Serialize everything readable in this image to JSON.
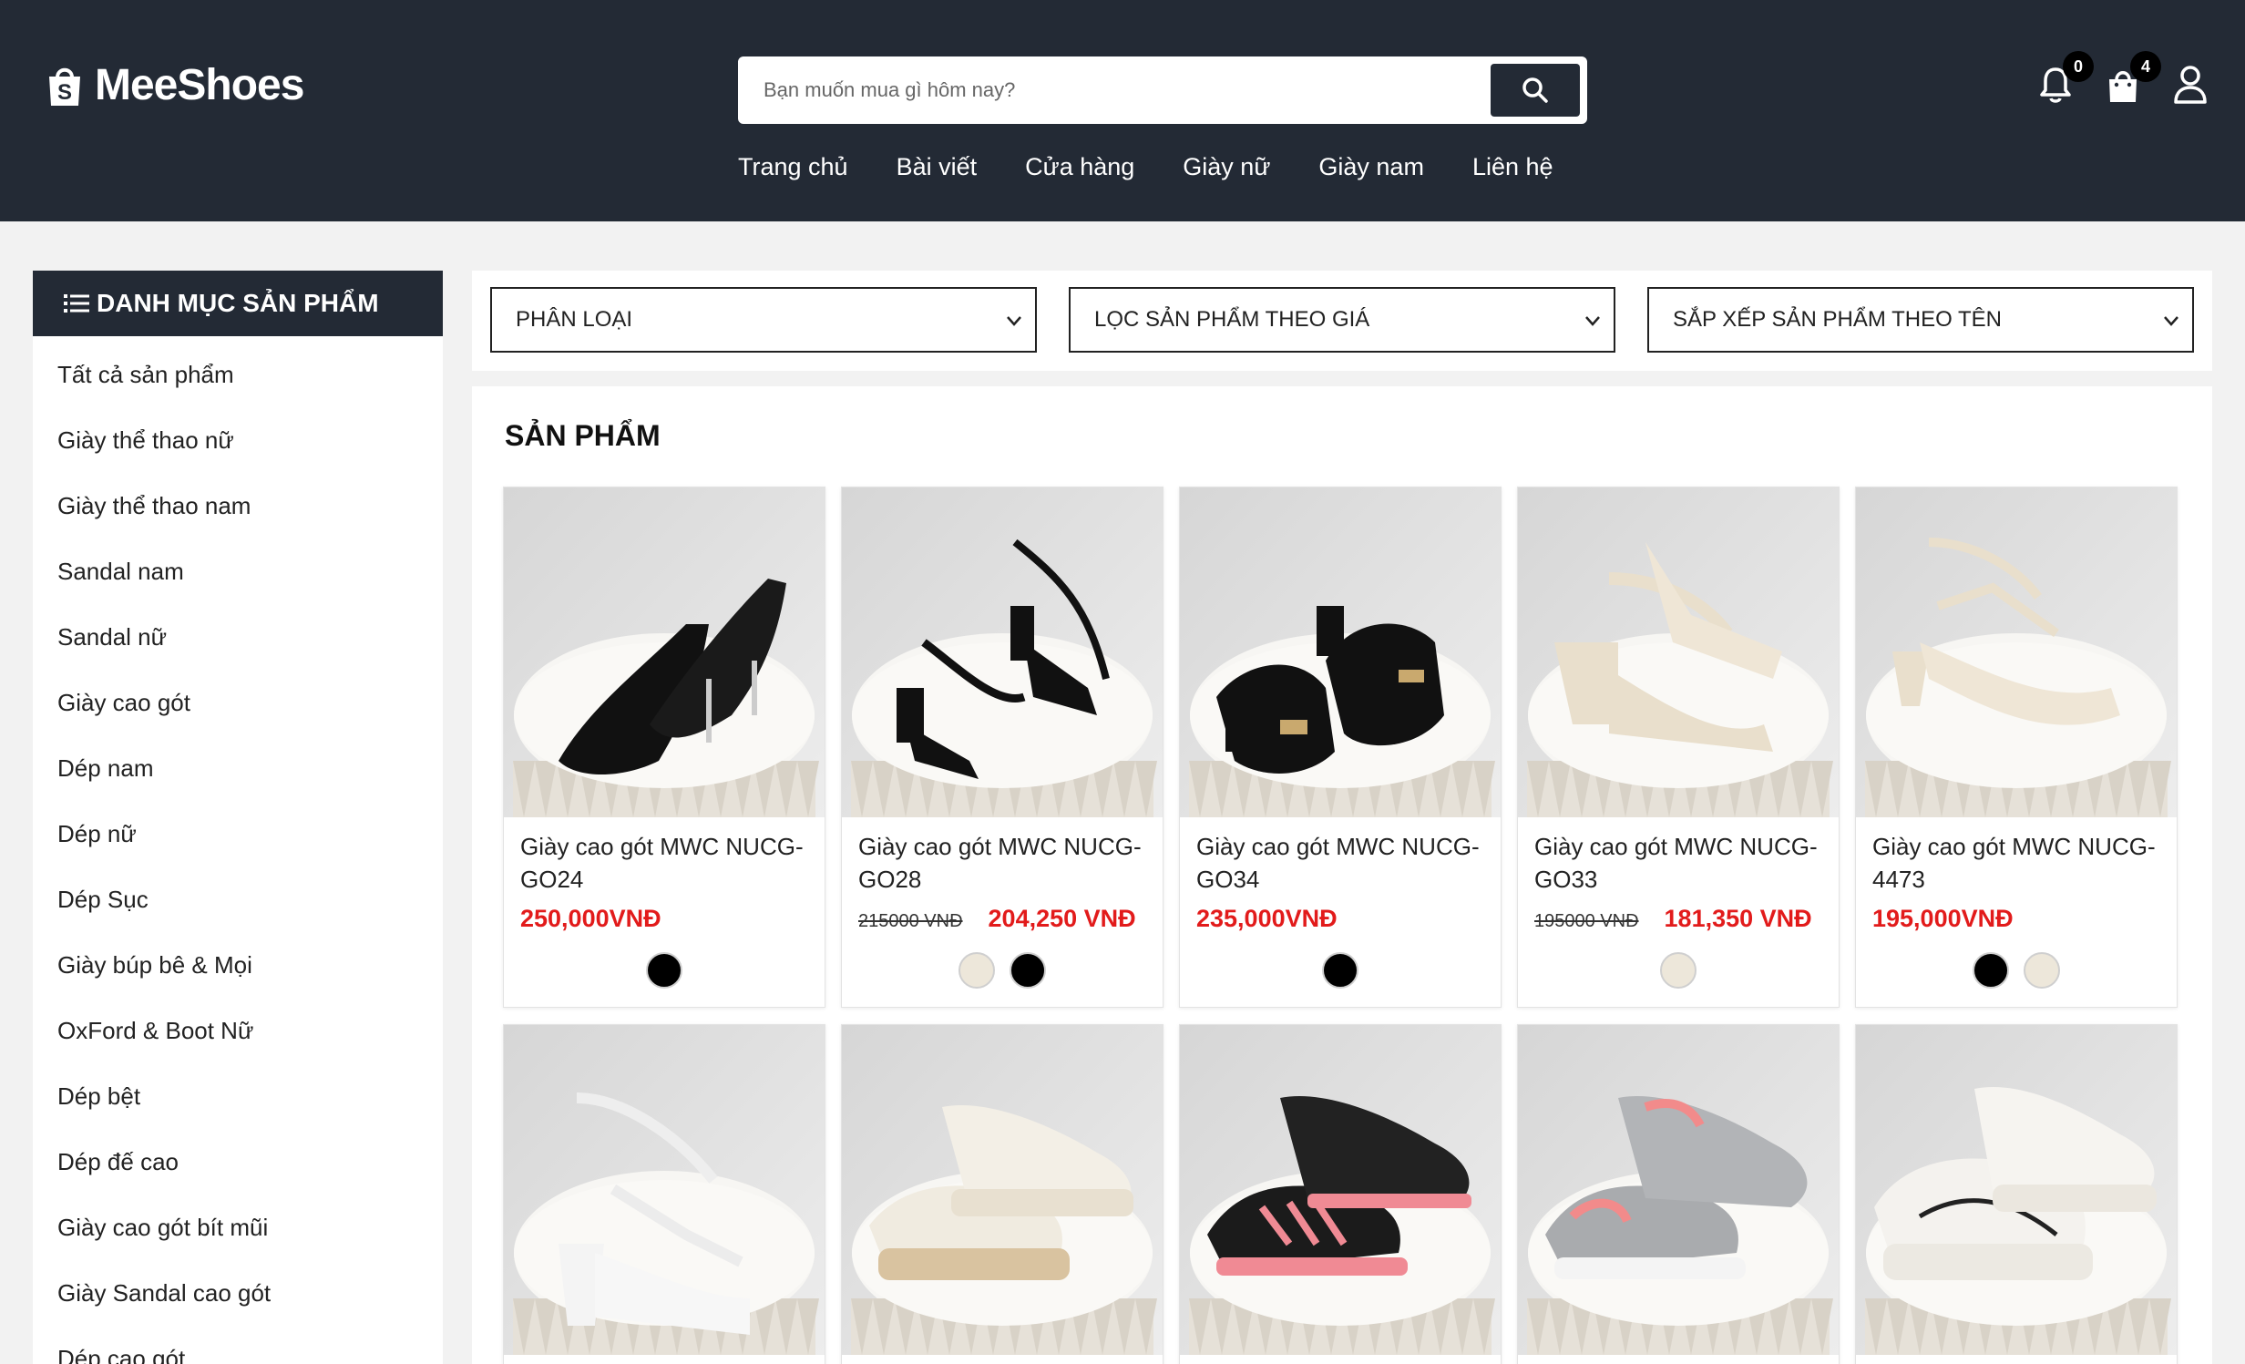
{
  "header": {
    "logo_text": "MeeShoes",
    "search_placeholder": "Bạn muốn mua gì hôm nay?",
    "nav": [
      "Trang chủ",
      "Bài viết",
      "Cửa hàng",
      "Giày nữ",
      "Giày nam",
      "Liên hệ"
    ],
    "notification_count": "0",
    "cart_count": "4"
  },
  "sidebar": {
    "title": "DANH MỤC SẢN PHẨM",
    "items": [
      "Tất cả sản phẩm",
      "Giày thể thao nữ",
      "Giày thể thao nam",
      "Sandal nam",
      "Sandal nữ",
      "Giày cao gót",
      "Dép nam",
      "Dép nữ",
      "Dép Sục",
      "Giày búp bê & Mọi",
      "OxFord & Boot Nữ",
      "Dép bệt",
      "Dép đế cao",
      "Giày cao gót bít mũi",
      "Giày Sandal cao gót",
      "Dép cao gót"
    ]
  },
  "filters": {
    "category": "PHÂN LOẠI",
    "price": "LỌC SẢN PHẨM THEO GIÁ",
    "sort": "SẮP XẾP SẢN PHẨM THEO TÊN"
  },
  "products": {
    "title": "SẢN PHẨM",
    "items": [
      {
        "name": "Giày cao gót MWC NUCG-GO24",
        "old_price": "",
        "price": "250,000VNĐ",
        "swatches": [
          "#000000"
        ],
        "icon": "black-pump-shoe"
      },
      {
        "name": "Giày cao gót MWC NUCG-GO28",
        "old_price": "215000 VNĐ",
        "price": "204,250 VNĐ",
        "swatches": [
          "#ede7da",
          "#000000"
        ],
        "icon": "black-strappy-sandal"
      },
      {
        "name": "Giày cao gót MWC NUCG-GO34",
        "old_price": "",
        "price": "235,000VNĐ",
        "swatches": [
          "#000000"
        ],
        "icon": "black-block-heel"
      },
      {
        "name": "Giày cao gót MWC NUCG-GO33",
        "old_price": "195000 VNĐ",
        "price": "181,350 VNĐ",
        "swatches": [
          "#ede7da"
        ],
        "icon": "cream-platform-sandal"
      },
      {
        "name": "Giày cao gót MWC NUCG-4473",
        "old_price": "",
        "price": "195,000VNĐ",
        "swatches": [
          "#000000",
          "#ede7da"
        ],
        "icon": "cream-heel-sandal"
      },
      {
        "name": "",
        "old_price": "",
        "price": "",
        "swatches": [],
        "icon": "white-platform-sandal"
      },
      {
        "name": "",
        "old_price": "",
        "price": "",
        "swatches": [],
        "icon": "cream-sneaker"
      },
      {
        "name": "",
        "old_price": "",
        "price": "",
        "swatches": [],
        "icon": "black-pink-sneaker"
      },
      {
        "name": "",
        "old_price": "",
        "price": "",
        "swatches": [],
        "icon": "grey-pink-sneaker"
      },
      {
        "name": "",
        "old_price": "",
        "price": "",
        "swatches": [],
        "icon": "white-chunky-sneaker"
      }
    ]
  },
  "colors": {
    "header_bg": "#232a35",
    "price_red": "#e21b1b",
    "page_bg": "#f2f2f2"
  }
}
